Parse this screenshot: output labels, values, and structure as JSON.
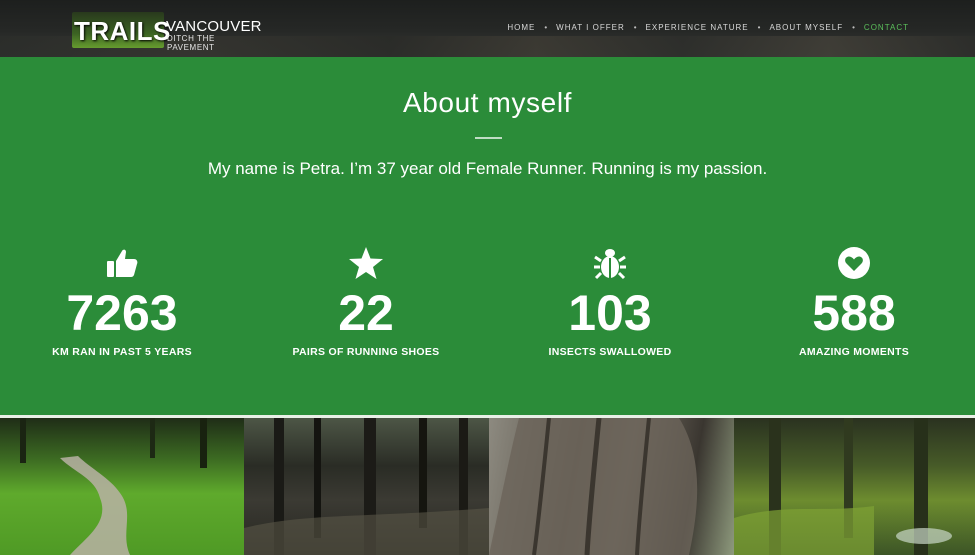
{
  "brand": {
    "logo_main": "TRAILS",
    "logo_city": "VANCOUVER",
    "logo_tagline": "DITCH THE PAVEMENT"
  },
  "nav": {
    "items": [
      {
        "label": "HOME",
        "active": false
      },
      {
        "label": "WHAT I OFFER",
        "active": false
      },
      {
        "label": "EXPERIENCE NATURE",
        "active": false
      },
      {
        "label": "ABOUT MYSELF",
        "active": false
      },
      {
        "label": "CONTACT",
        "active": true
      }
    ],
    "separator": "•"
  },
  "about": {
    "title": "About myself",
    "text": "My name is Petra. I’m 37 year old Female Runner. Running is my passion."
  },
  "stats": [
    {
      "icon": "thumbs-up-icon",
      "value": "7263",
      "label": "KM RAN IN PAST 5 YEARS"
    },
    {
      "icon": "star-icon",
      "value": "22",
      "label": "PAIRS OF RUNNING SHOES"
    },
    {
      "icon": "bug-icon",
      "value": "103",
      "label": "INSECTS SWALLOWED"
    },
    {
      "icon": "heart-icon",
      "value": "588",
      "label": "AMAZING MOMENTS"
    }
  ],
  "colors": {
    "section_green": "#2b8c39",
    "active_nav": "#5bbf5b",
    "text": "#ffffff"
  },
  "photos": [
    "forest-trail-photo",
    "dark-forest-photo",
    "tree-trunk-photo",
    "mossy-forest-photo"
  ]
}
